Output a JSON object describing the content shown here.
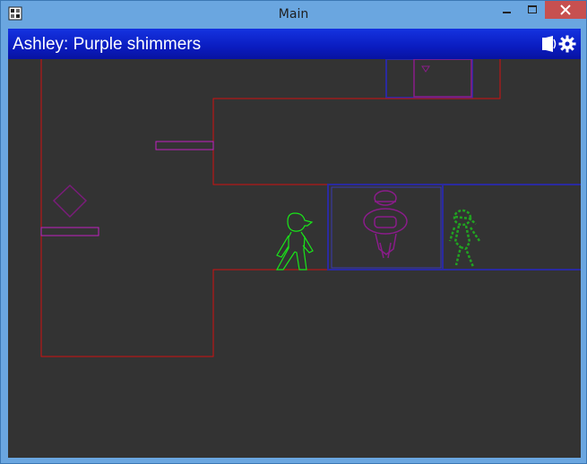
{
  "window": {
    "title": "Main",
    "buttons": {
      "minimize": "minimize",
      "maximize": "maximize",
      "close": "close"
    }
  },
  "header": {
    "status_text": "Ashley: Purple shimmers",
    "icons": [
      "sound-icon",
      "settings-gear-icon"
    ]
  },
  "colors": {
    "window_frame": "#6aa6e0",
    "header_bar": "#0a1cc0",
    "play_area": "#333333",
    "walls": "#d01010",
    "platforms": "#c020c0",
    "portal_frame": "#2a2aa0",
    "player": "#19e619",
    "ghost_npc": "#21a321",
    "purple_figure": "#8a1c8a"
  },
  "scene": {
    "entities": [
      "player-character",
      "purple-shimmer-figure",
      "green-ghost-figure",
      "diamond-crystal",
      "platform-left-upper",
      "platform-left-lower"
    ]
  }
}
